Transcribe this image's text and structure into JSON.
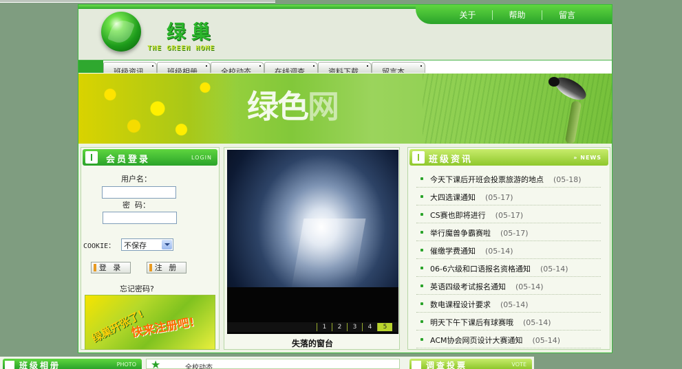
{
  "header": {
    "logo_title": "绿巢",
    "logo_subtitle": "THE GREEN HOME",
    "top_links": [
      "关于",
      "帮助",
      "留言"
    ]
  },
  "nav": {
    "tabs": [
      "班级资讯",
      "班级相册",
      "全校动态",
      "在线调查",
      "资料下载",
      "留言本"
    ]
  },
  "banner": {
    "text_main": "绿色",
    "text_faded": "网"
  },
  "login": {
    "title": "会员登录",
    "title_en": "LOGIN",
    "username_label": "用户名：",
    "password_label": "密  码：",
    "cookie_label": "COOKIE：",
    "cookie_selected": "不保存",
    "login_button": "登 录",
    "register_button": "注 册",
    "forgot_link": "忘记密码?",
    "ad_text_1": "绿巢开张了!",
    "ad_text_2": "快来注册吧!"
  },
  "photo": {
    "caption": "失落的窗台",
    "pages": [
      "1",
      "2",
      "3",
      "4",
      "5"
    ],
    "active_page": "5"
  },
  "news": {
    "title": "班级资讯",
    "title_en": "NEWS",
    "items": [
      {
        "title": "今天下课后开班会投票旅游的地点",
        "date": "(05-18)"
      },
      {
        "title": "大四选课通知",
        "date": "(05-17)"
      },
      {
        "title": "CS赛也即将进行",
        "date": "(05-17)"
      },
      {
        "title": "举行魔兽争霸赛啦",
        "date": "(05-17)"
      },
      {
        "title": "催缴学费通知",
        "date": "(05-14)"
      },
      {
        "title": "06-6六级和口语报名资格通知",
        "date": "(05-14)"
      },
      {
        "title": "英语四级考试报名通知",
        "date": "(05-14)"
      },
      {
        "title": "数电课程设计要求",
        "date": "(05-14)"
      },
      {
        "title": "明天下午下课后有球赛哦",
        "date": "(05-14)"
      },
      {
        "title": "ACM协会网页设计大赛通知",
        "date": "(05-14)"
      }
    ]
  },
  "bottom": {
    "album_title": "班级相册",
    "album_en": "PHOTO",
    "school_title": "全校动态",
    "survey_title": "调查投票",
    "survey_en": "VOTE"
  },
  "colors": {
    "brand_green": "#2aa32a",
    "light_green": "#8ec72c",
    "page_bg": "#7f9d80"
  }
}
